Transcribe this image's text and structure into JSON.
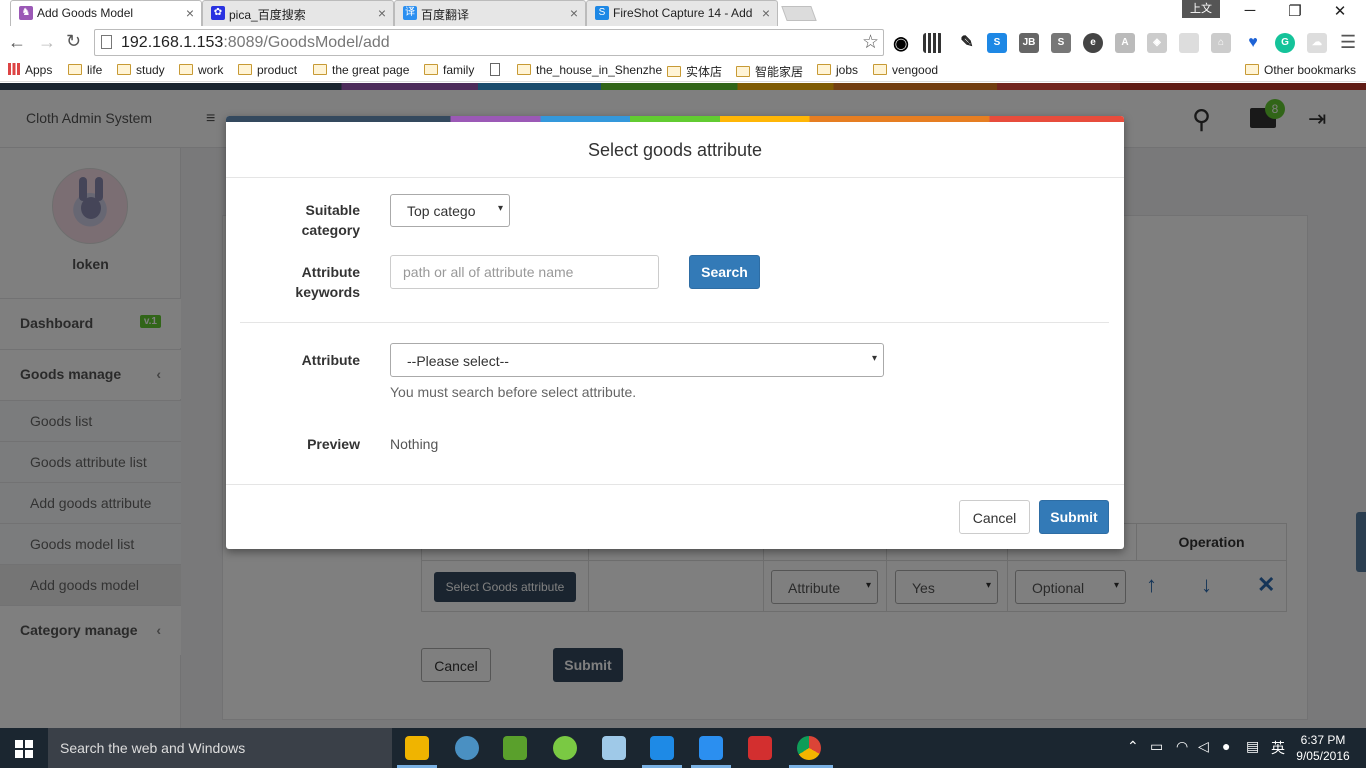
{
  "browser": {
    "tabs": [
      {
        "title": "Add Goods Model",
        "icon": "bunny-favicon",
        "color": "#9b59b6",
        "active": true
      },
      {
        "title": "pica_百度搜索",
        "icon": "baidu-paw-icon",
        "color": "#2932e1"
      },
      {
        "title": "百度翻译",
        "icon": "baidu-translate-icon",
        "glyph": "译",
        "color": "#2b8ff0"
      },
      {
        "title": "FireShot Capture 14 - Add",
        "icon": "fireshot-icon",
        "glyph": "S",
        "color": "#1e88e5"
      }
    ],
    "ime_label": "上文",
    "url_host": "192.168.1.153",
    "url_rest": ":8089/GoodsModel/add",
    "bookmarks": [
      "Apps",
      "life",
      "study",
      "work",
      "product",
      "the great page",
      "family",
      "the_house_in_Shenzhe",
      "实体店",
      "智能家居",
      "jobs",
      "vengood"
    ],
    "other_bookmarks": "Other bookmarks"
  },
  "app": {
    "brand": "Cloth Admin System",
    "username": "loken",
    "notification_count": "8",
    "nav": {
      "dashboard": "Dashboard",
      "version_badge": "v.1",
      "goods_manage": "Goods manage",
      "goods_items": [
        "Goods list",
        "Goods attribute list",
        "Add goods attribute",
        "Goods model list",
        "Add goods model"
      ],
      "category_manage": "Category manage"
    },
    "table": {
      "operation_header": "Operation",
      "select_attr_button": "Select Goods attribute",
      "type_select": "Attribute",
      "required_select": "Yes",
      "optional_select": "Optional"
    },
    "cancel": "Cancel",
    "submit": "Submit"
  },
  "modal": {
    "title": "Select goods attribute",
    "suitable_label_1": "Suitable",
    "suitable_label_2": "category",
    "category_value": "Top catego",
    "keywords_label_1": "Attribute",
    "keywords_label_2": "keywords",
    "keywords_placeholder": "path or all of attribute name",
    "search_button": "Search",
    "attribute_label": "Attribute",
    "attribute_value": "--Please select--",
    "help_text": "You must search before select attribute.",
    "preview_label": "Preview",
    "preview_value": "Nothing",
    "cancel": "Cancel",
    "submit": "Submit"
  },
  "taskbar": {
    "search_placeholder": "Search the web and Windows",
    "time": "6:37 PM",
    "date": "9/05/2016",
    "ime": "英"
  }
}
